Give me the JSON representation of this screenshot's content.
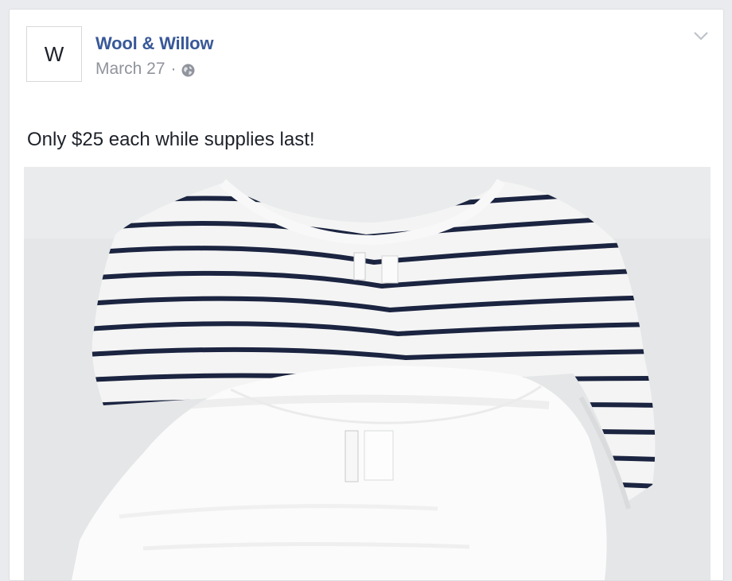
{
  "post": {
    "avatar_letter": "W",
    "page_name": "Wool & Willow",
    "date": "March 27",
    "separator": "·",
    "privacy_icon": "globe-icon",
    "menu_icon": "chevron-down-icon",
    "text": "Only $25 each while supplies last!",
    "photo": {
      "subject": "striped-and-white-t-shirts"
    }
  },
  "colors": {
    "page_background": "#e9ebee",
    "card_background": "#ffffff",
    "link_blue": "#385898",
    "meta_gray": "#90949c",
    "stripe_navy": "#1b2440"
  }
}
